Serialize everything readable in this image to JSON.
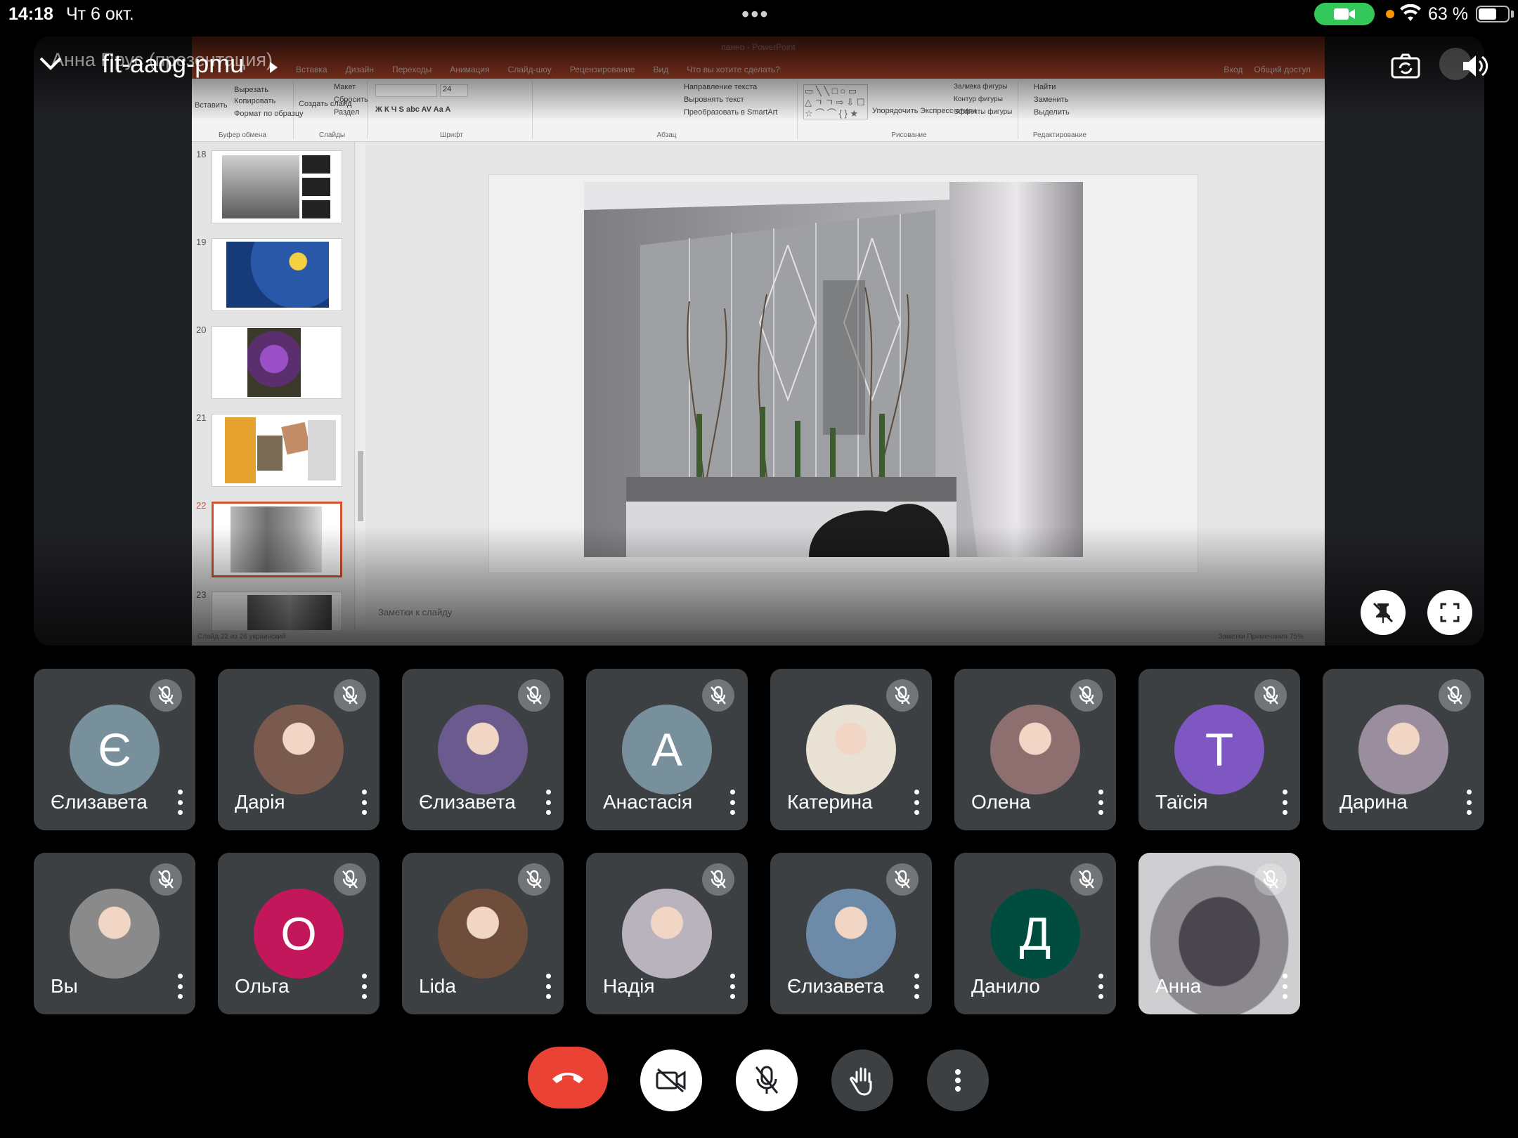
{
  "status_bar": {
    "time": "14:18",
    "date": "Чт 6 окт.",
    "battery_text": "63 %",
    "battery_level": 0.63,
    "camera_indicator_color": "#34c759"
  },
  "meeting": {
    "code": "fit-aaog-pmu",
    "presenter_label": "Анна Прус (презентация)"
  },
  "presentation": {
    "window_title": "панно - PowerPoint",
    "tabs": [
      "Вставка",
      "Дизайн",
      "Переходы",
      "Анимация",
      "Слайд-шоу",
      "Рецензирование",
      "Вид",
      "Что вы хотите сделать?"
    ],
    "tabs_right": [
      "Вход",
      "Общий доступ"
    ],
    "ribbon": {
      "clipboard": {
        "paste": "Вставить",
        "cut": "Вырезать",
        "copy": "Копировать",
        "format": "Формат по образцу",
        "group": "Буфер обмена"
      },
      "slides": {
        "new_slide": "Создать слайд",
        "layout": "Макет",
        "reset": "Сбросить",
        "section": "Раздел",
        "group": "Слайды"
      },
      "font": {
        "size": "24",
        "group": "Шрифт"
      },
      "paragraph": {
        "direction": "Направление текста",
        "align": "Выровнять текст",
        "smartart": "Преобразовать в SmartArt",
        "group": "Абзац"
      },
      "drawing": {
        "arrange": "Упорядочить",
        "quick_styles": "Экспресс-стили",
        "fill": "Заливка фигуры",
        "outline": "Контур фигуры",
        "effects": "Эффекты фигуры",
        "group": "Рисование"
      },
      "editing": {
        "find": "Найти",
        "replace": "Заменить",
        "select": "Выделить",
        "group": "Редактирование"
      }
    },
    "thumbnails": [
      {
        "num": "18"
      },
      {
        "num": "19"
      },
      {
        "num": "20"
      },
      {
        "num": "21"
      },
      {
        "num": "22",
        "selected": true
      },
      {
        "num": "23"
      }
    ],
    "notes_placeholder": "Заметки к слайду",
    "status_left": "Слайд 22 из 26    украинский",
    "status_right": "Заметки    Примечания    75%"
  },
  "participants": [
    {
      "name": "Єлизавета",
      "initial": "Є",
      "color": "#78909c",
      "muted": true
    },
    {
      "name": "Дарія",
      "initial": "",
      "photo": "#7a5a4e",
      "muted": true
    },
    {
      "name": "Єлизавета",
      "initial": "",
      "photo": "#6a5a8e",
      "muted": true
    },
    {
      "name": "Анастасія",
      "initial": "А",
      "color": "#78909c",
      "muted": true
    },
    {
      "name": "Катерина",
      "initial": "",
      "photo": "#e9e2d4",
      "muted": true
    },
    {
      "name": "Олена",
      "initial": "",
      "photo": "#8e6f70",
      "muted": true
    },
    {
      "name": "Таїсія",
      "initial": "Т",
      "color": "#7e57c2",
      "muted": true
    },
    {
      "name": "Дарина",
      "initial": "",
      "photo": "#9a8d9e",
      "muted": true
    },
    {
      "name": "Вы",
      "initial": "",
      "photo": "#8a8a8a",
      "muted": true
    },
    {
      "name": "Ольга",
      "initial": "О",
      "color": "#c2185b",
      "muted": true
    },
    {
      "name": "Lida",
      "initial": "",
      "photo": "#6e4d3b",
      "muted": true
    },
    {
      "name": "Надія",
      "initial": "",
      "photo": "#b9b3bd",
      "muted": true
    },
    {
      "name": "Єлизавета",
      "initial": "",
      "photo": "#6d8aa8",
      "muted": true
    },
    {
      "name": "Данило",
      "initial": "Д",
      "color": "#004d40",
      "muted": true
    },
    {
      "name": "Анна",
      "initial": "",
      "video": true,
      "muted": true
    }
  ],
  "controls": {
    "end_call_color": "#ea4335",
    "buttons": [
      "end-call",
      "camera-off",
      "mic-off",
      "raise-hand",
      "more-options"
    ]
  }
}
